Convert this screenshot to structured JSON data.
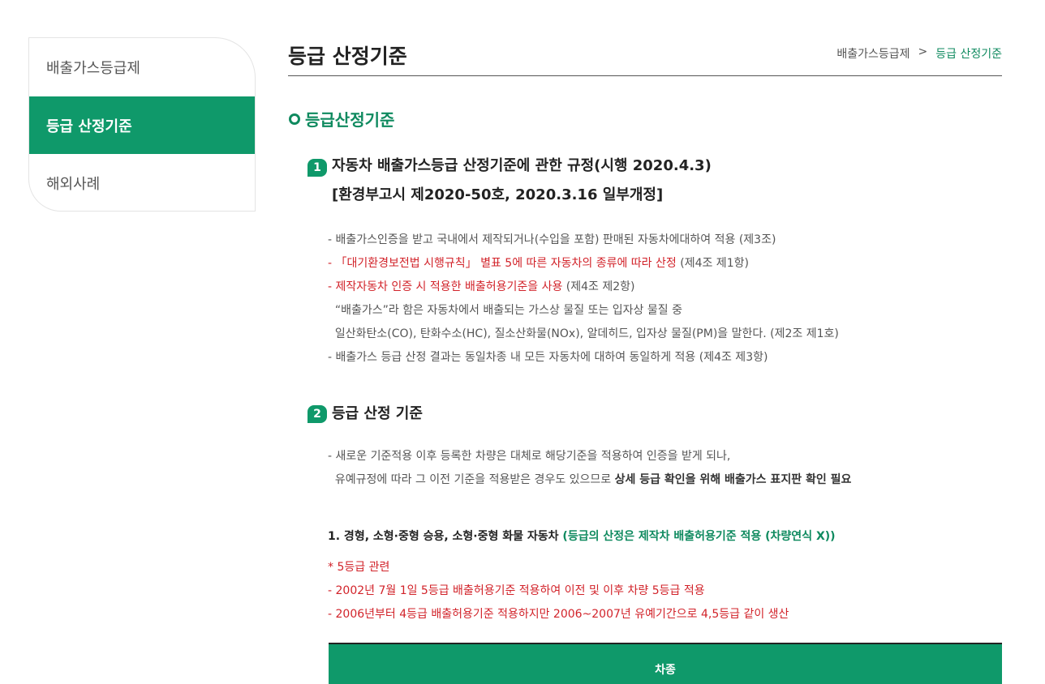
{
  "sidebar": {
    "items": [
      {
        "label": "배출가스등급제"
      },
      {
        "label": "등급 산정기준"
      },
      {
        "label": "해외사례"
      }
    ]
  },
  "header": {
    "title": "등급 산정기준",
    "breadcrumb": [
      "배출가스등급제",
      ">",
      "등급 산정기준"
    ]
  },
  "section": {
    "title": "등급산정기준"
  },
  "block1": {
    "number": "1",
    "title_line1": "자동차 배출가스등급 산정기준에 관한 규정(시행 2020.4.3)",
    "title_line2": "[환경부고시 제2020-50호, 2020.3.16 일부개정]",
    "rows": [
      "- 배출가스인증을 받고 국내에서 제작되거나(수입을 포함) 판매된 자동차에대하여 적용 (제3조)",
      {
        "red": "- 「대기환경보전법 시행규칙」 별표 5에 따른 자동차의 종류에 따라 산정",
        "rest": " (제4조 제1항)"
      },
      {
        "red": "- 제작자동차 인증 시 적용한 배출허용기준을 사용",
        "rest": " (제4조 제2항)"
      },
      "  “배출가스”라 함은 자동차에서 배출되는 가스상 물질 또는 입자상 물질 중",
      "  일산화탄소(CO), 탄화수소(HC), 질소산화물(NOx), 알데히드, 입자상 물질(PM)을 말한다. (제2조 제1호)",
      "- 배출가스 등급 산정 결과는 동일차종 내 모든 자동차에 대하여 동일하게 적용 (제4조 제3항)"
    ]
  },
  "block2": {
    "number": "2",
    "title": "등급 산정 기준",
    "row1": "- 새로운 기준적용 이후 등록한 차량은 대체로 해당기준을 적용하여 인증을 받게 되나,",
    "row2_plain": "  유예규정에 따라 그 이전 기준을 적용받은 경우도 있으므로 ",
    "row2_bold": "상세 등급 확인을 위해 배출가스 표지판 확인 필요"
  },
  "subsection": {
    "title": "1. 경형, 소형·중형 승용, 소형·중형 화물 자동차 ",
    "note": "(등급의 산정은 제작차 배출허용기준 적용 (차량연식 X))",
    "red_rows": [
      "* 5등급 관련",
      "- 2002년 7월 1일 5등급 배출허용기준 적용하여 이전 및 이후 차량 5등급 적용",
      "- 2006년부터 4등급 배출허용기준 적용하지만 2006~2007년 유예기간으로 4,5등급 같이 생산"
    ]
  },
  "table": {
    "header": "차종"
  },
  "colors": {
    "accent": "#0f996a",
    "accent_text": "#0f8a5f",
    "warning": "#d2232a"
  }
}
